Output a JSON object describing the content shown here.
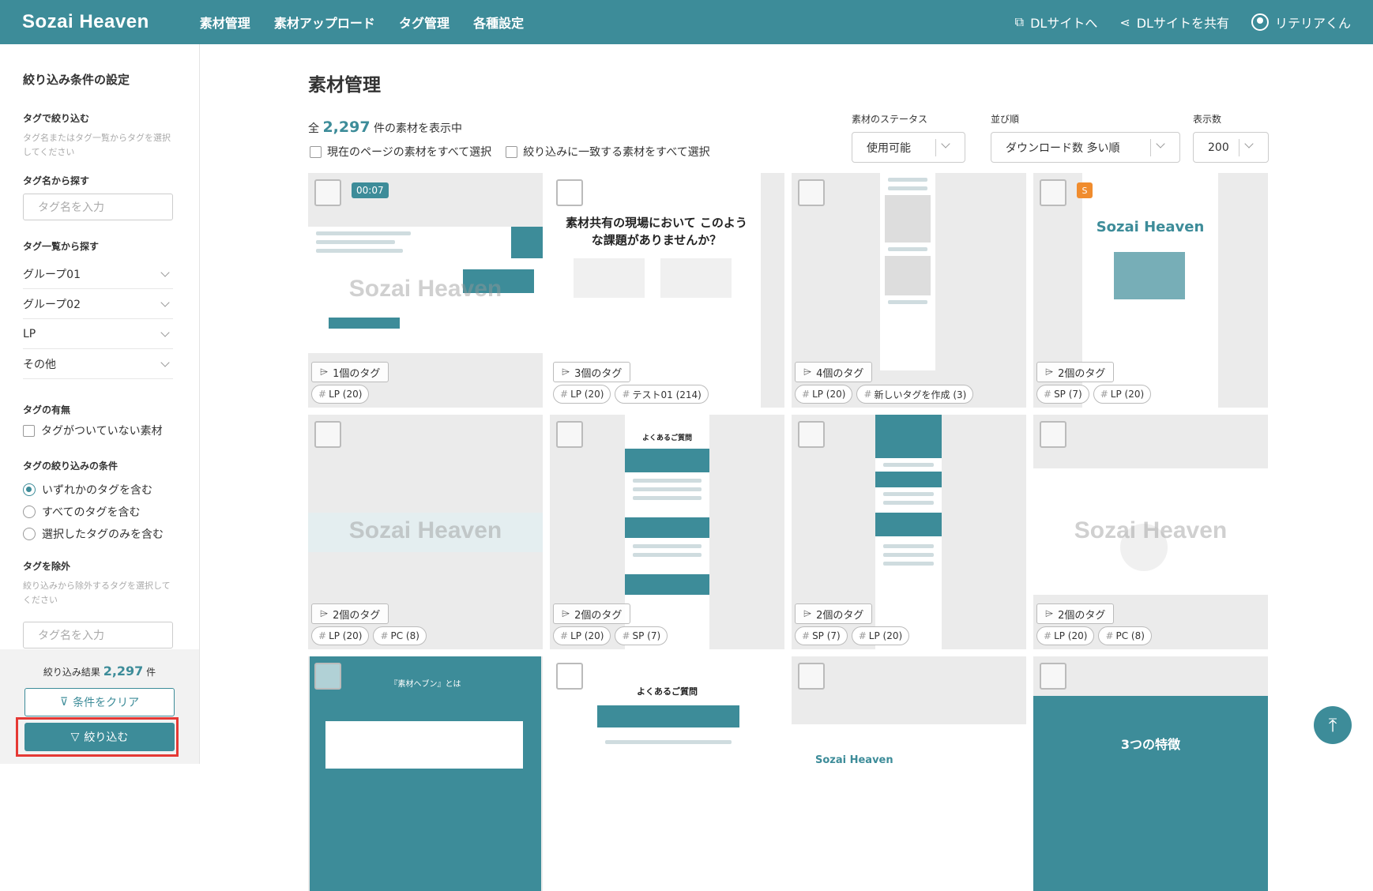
{
  "brand": "Sozai Heaven",
  "nav": [
    "素材管理",
    "素材アップロード",
    "タグ管理",
    "各種設定"
  ],
  "topright": {
    "dl_site": "DLサイトへ",
    "share": "DLサイトを共有",
    "user": "リテリアくん"
  },
  "sidebar": {
    "title": "絞り込み条件の設定",
    "tag_filter_heading": "タグで絞り込む",
    "tag_filter_note": "タグ名またはタグ一覧からタグを選択してください",
    "search_by_name": "タグ名から探す",
    "tag_input_placeholder": "タグ名を入力",
    "search_by_list": "タグ一覧から探す",
    "groups": [
      "グループ01",
      "グループ02",
      "LP",
      "その他"
    ],
    "has_tag_heading": "タグの有無",
    "no_tag_label": "タグがついていない素材",
    "condition_heading": "タグの絞り込みの条件",
    "conditions": [
      "いずれかのタグを含む",
      "すべてのタグを含む",
      "選択したタグのみを含む"
    ],
    "exclude_heading": "タグを除外",
    "exclude_note": "絞り込みから除外するタグを選択してください",
    "exclude_placeholder": "タグ名を入力",
    "result_prefix": "絞り込み結果",
    "result_count": "2,297",
    "result_suffix": "件",
    "clear_label": "条件をクリア",
    "apply_label": "絞り込む"
  },
  "main": {
    "title": "素材管理",
    "count_prefix": "全",
    "count": "2,297",
    "count_suffix": "件の素材を表示中",
    "select_page": "現在のページの素材をすべて選択",
    "select_all": "絞り込みに一致する素材をすべて選択",
    "status_label": "素材のステータス",
    "status_value": "使用可能",
    "sort_label": "並び順",
    "sort_value": "ダウンロード数 多い順",
    "per_page_label": "表示数",
    "per_page_value": "200"
  },
  "cards": [
    {
      "tags_label": "1個のタグ",
      "chips": [
        "LP (20)"
      ],
      "duration": "00:07",
      "watermark": "Sozai Heaven"
    },
    {
      "tags_label": "3個のタグ",
      "chips": [
        "LP (20)",
        "テスト01 (214)"
      ],
      "heading": "素材共有の現場において このような課題がありませんか？"
    },
    {
      "tags_label": "4個のタグ",
      "chips": [
        "LP (20)",
        "新しいタグを作成 (3)"
      ]
    },
    {
      "tags_label": "2個のタグ",
      "chips": [
        "SP (7)",
        "LP (20)"
      ],
      "badge": "S",
      "heading": "Sozai Heaven"
    },
    {
      "tags_label": "2個のタグ",
      "chips": [
        "LP (20)",
        "PC (8)"
      ],
      "watermark": "Sozai Heaven"
    },
    {
      "tags_label": "2個のタグ",
      "chips": [
        "LP (20)",
        "SP (7)"
      ],
      "heading": "よくあるご質問"
    },
    {
      "tags_label": "2個のタグ",
      "chips": [
        "SP (7)",
        "LP (20)"
      ]
    },
    {
      "tags_label": "2個のタグ",
      "chips": [
        "LP (20)",
        "PC (8)"
      ],
      "watermark": "Sozai Heaven"
    },
    {
      "heading": "『素材ヘブン』とは"
    },
    {
      "heading": "よくあるご質問"
    },
    {
      "heading": "Sozai Heaven"
    },
    {
      "heading": "3つの特徴"
    }
  ]
}
